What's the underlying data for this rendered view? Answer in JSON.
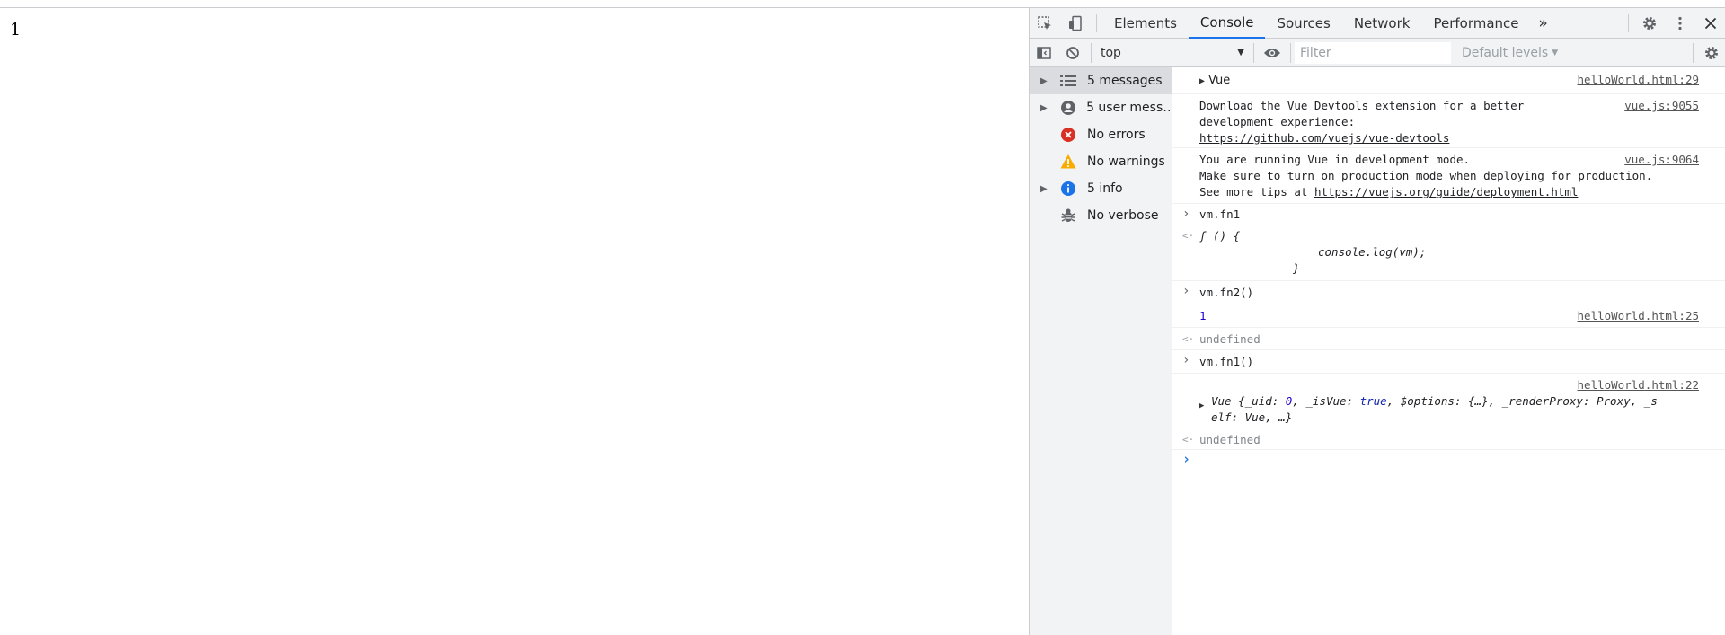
{
  "page": {
    "text": "1"
  },
  "tabs": [
    {
      "label": "Elements",
      "active": false
    },
    {
      "label": "Console",
      "active": true
    },
    {
      "label": "Sources",
      "active": false
    },
    {
      "label": "Network",
      "active": false
    },
    {
      "label": "Performance",
      "active": false
    }
  ],
  "tabs_more": "»",
  "toolbar": {
    "context": "top",
    "filter_placeholder": "Filter",
    "levels": "Default levels"
  },
  "sidebar": {
    "items": [
      {
        "label": "5 messages",
        "icon": "list-icon",
        "expandable": true,
        "selected": true
      },
      {
        "label": "5 user mess…",
        "icon": "user-icon",
        "expandable": true,
        "selected": false
      },
      {
        "label": "No errors",
        "icon": "error-icon",
        "expandable": false,
        "selected": false
      },
      {
        "label": "No warnings",
        "icon": "warning-icon",
        "expandable": false,
        "selected": false
      },
      {
        "label": "5 info",
        "icon": "info-icon",
        "expandable": true,
        "selected": false
      },
      {
        "label": "No verbose",
        "icon": "bug-icon",
        "expandable": false,
        "selected": false
      }
    ]
  },
  "console": {
    "m1": {
      "text": "Vue",
      "src": "helloWorld.html:29"
    },
    "m2": {
      "line1": "Download the Vue Devtools extension for a better",
      "line2": "development experience:",
      "link": "https://github.com/vuejs/vue-devtools",
      "src": "vue.js:9055"
    },
    "m3": {
      "line1": "You are running Vue in development mode.",
      "line2": "Make sure to turn on production mode when deploying for production.",
      "line3_prefix": "See more tips at ",
      "link": "https://vuejs.org/guide/deployment.html",
      "src": "vue.js:9064"
    },
    "i1": {
      "text": "vm.fn1"
    },
    "r1": {
      "line1": "ƒ () {",
      "line2": "console.log(vm);",
      "line3": "}"
    },
    "i2": {
      "text": "vm.fn2()"
    },
    "o2": {
      "text": "1",
      "src": "helloWorld.html:25"
    },
    "r2": {
      "text": "undefined"
    },
    "i3": {
      "text": "vm.fn1()"
    },
    "o3": {
      "src": "helloWorld.html:22",
      "p1": "Vue {_uid: ",
      "p2": "0",
      "p3": ", _isVue: ",
      "p4": "true",
      "p5": ", $options: {…}, _renderProxy: Proxy, _s",
      "p6": "elf: Vue, …}"
    },
    "r3": {
      "text": "undefined"
    }
  },
  "glyphs": {
    "input_prompt": "›",
    "result_arrow": "<·",
    "expand": "▶"
  },
  "colors": {
    "accent": "#1a73e8",
    "error": "#d93025",
    "warning": "#f9ab00",
    "info": "#1a73e8"
  }
}
